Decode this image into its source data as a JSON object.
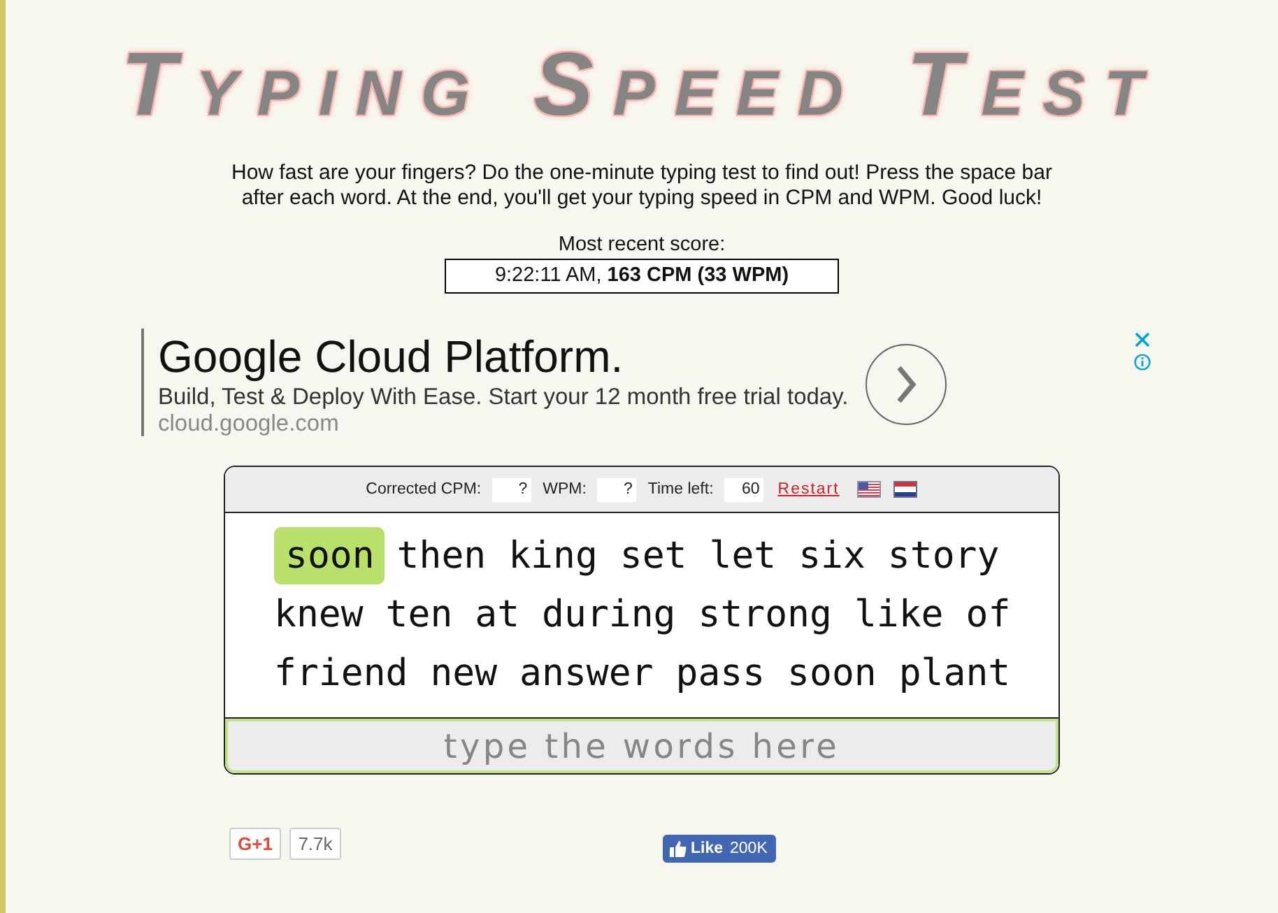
{
  "logo": {
    "title": "Typing Speed Test"
  },
  "intro": "How fast are your fingers? Do the one-minute typing test to find out! Press the space bar after each word. At the end, you'll get your typing speed in CPM and WPM. Good luck!",
  "recent_score": {
    "label": "Most recent score:",
    "value": "9:22:11 AM, **163 CPM (33 WPM)**"
  },
  "ad": {
    "headline": "Google Cloud Platform.",
    "description": "Build, Test & Deploy With Ease. Start your 12 month free trial today.",
    "url": "cloud.google.com"
  },
  "test": {
    "stats": [
      {
        "label": "Corrected CPM:",
        "value": "?"
      },
      {
        "label": "WPM:",
        "value": "?"
      },
      {
        "label": "Time left:",
        "value": "60"
      }
    ],
    "restart": "Restart",
    "words": [
      {
        "text": "soon",
        "current": true
      },
      {
        "text": "then",
        "current": false
      },
      {
        "text": "king",
        "current": false
      },
      {
        "text": "set",
        "current": false
      },
      {
        "text": "let",
        "current": false
      },
      {
        "text": "six",
        "current": false
      },
      {
        "text": "story",
        "current": false
      },
      {
        "text": "knew",
        "current": false
      },
      {
        "text": "ten",
        "current": false
      },
      {
        "text": "at",
        "current": false
      },
      {
        "text": "during",
        "current": false
      },
      {
        "text": "strong",
        "current": false
      },
      {
        "text": "like",
        "current": false
      },
      {
        "text": "of",
        "current": false
      },
      {
        "text": "friend",
        "current": false
      },
      {
        "text": "new",
        "current": false
      },
      {
        "text": "answer",
        "current": false
      },
      {
        "text": "pass",
        "current": false
      },
      {
        "text": "soon",
        "current": false
      },
      {
        "text": "plant",
        "current": false
      }
    ],
    "input": {
      "placeholder": "type the words here"
    }
  },
  "social": {
    "plus_one": {
      "label": "G+1",
      "count": "7.7k"
    },
    "like": {
      "label": "Like",
      "count": "200K"
    }
  }
}
